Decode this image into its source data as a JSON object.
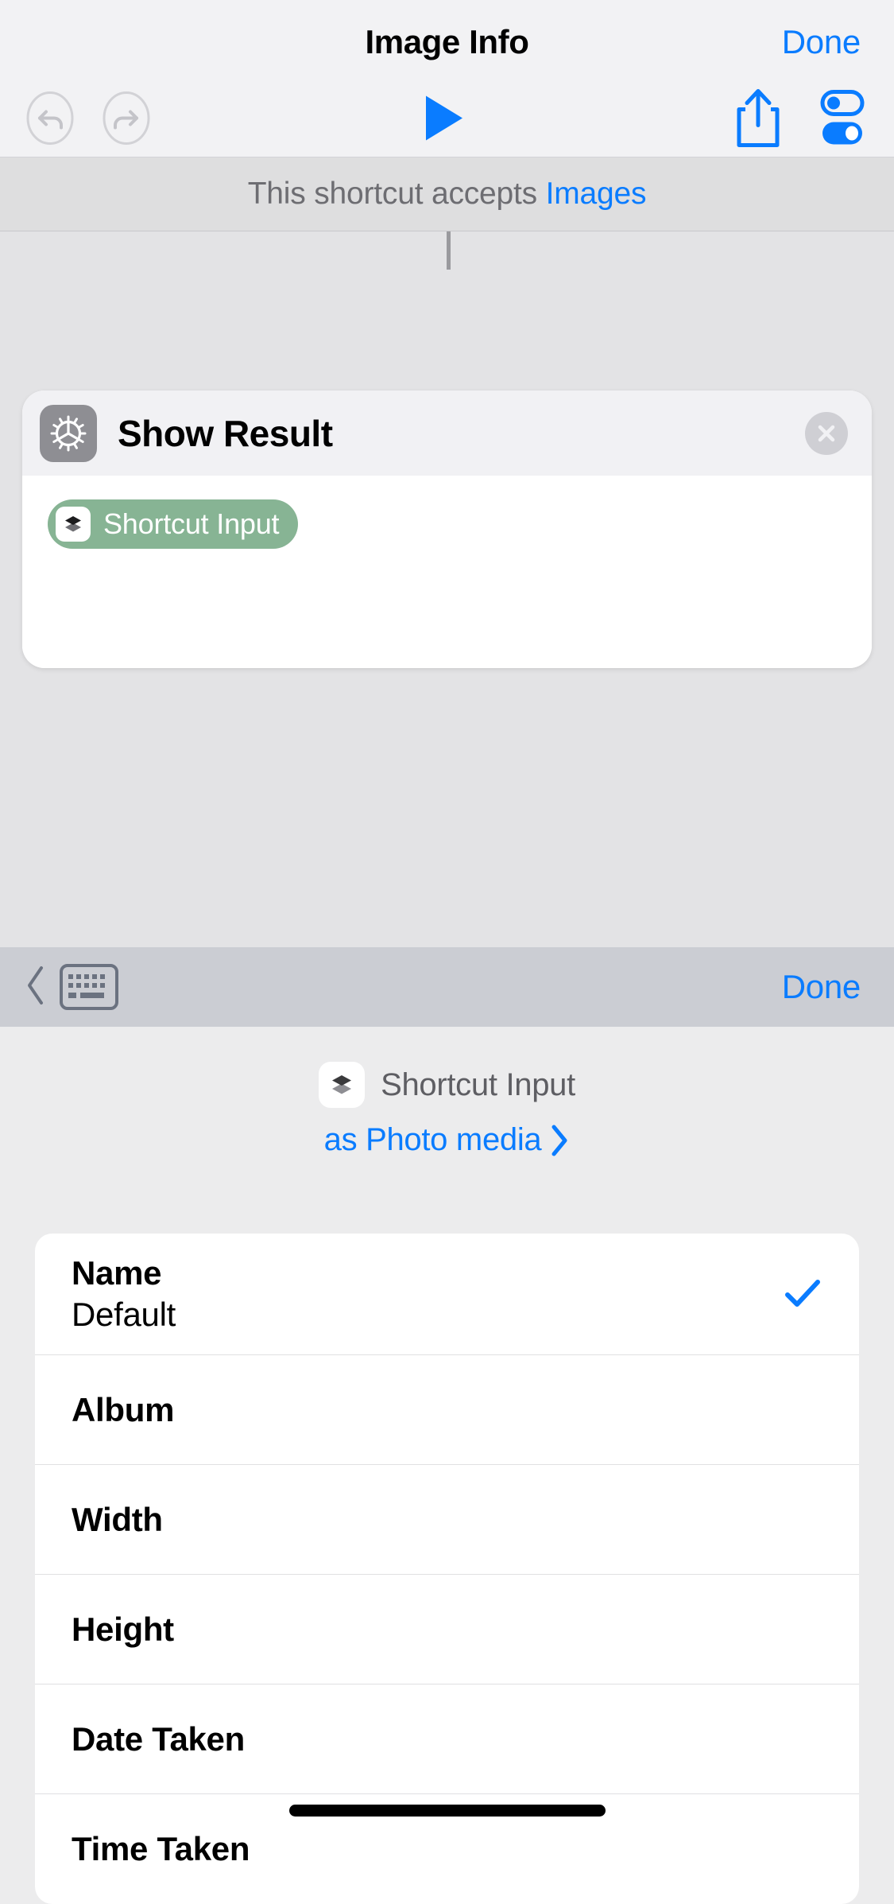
{
  "navbar": {
    "title": "Image Info",
    "done_label": "Done"
  },
  "toolbar": {
    "icons": [
      {
        "name": "undo-icon",
        "label": "Undo",
        "enabled": false
      },
      {
        "name": "redo-icon",
        "label": "Redo",
        "enabled": false
      },
      {
        "name": "play-icon",
        "label": "Run",
        "enabled": true
      },
      {
        "name": "share-icon",
        "label": "Share",
        "enabled": true
      },
      {
        "name": "settings-toggles-icon",
        "label": "Settings",
        "enabled": true
      }
    ]
  },
  "accepts_banner": {
    "prefix": "This shortcut accepts ",
    "link": "Images"
  },
  "action_card": {
    "icon": "gear-icon",
    "title": "Show Result",
    "close_label": "×",
    "token": {
      "icon": "shortcut-input-icon",
      "label": "Shortcut Input"
    }
  },
  "keyboard_bar": {
    "back_chevron": "‹",
    "keyboard_icon": "keyboard-icon",
    "done_label": "Done"
  },
  "variable_panel": {
    "icon": "shortcut-input-icon",
    "name": "Shortcut Input",
    "subtitle": "as Photo media",
    "subtitle_chevron": "›",
    "options": [
      {
        "title": "Name",
        "subtitle": "Default",
        "checked": true
      },
      {
        "title": "Album",
        "subtitle": "",
        "checked": false
      },
      {
        "title": "Width",
        "subtitle": "",
        "checked": false
      },
      {
        "title": "Height",
        "subtitle": "",
        "checked": false
      },
      {
        "title": "Date Taken",
        "subtitle": "",
        "checked": false
      },
      {
        "title": "Time Taken",
        "subtitle": "",
        "checked": false
      }
    ]
  },
  "colors": {
    "accent_blue": "#0a7cff",
    "token_green": "#87b494",
    "gear_gray": "#8e8e93",
    "banner_gray": "#dededf"
  }
}
